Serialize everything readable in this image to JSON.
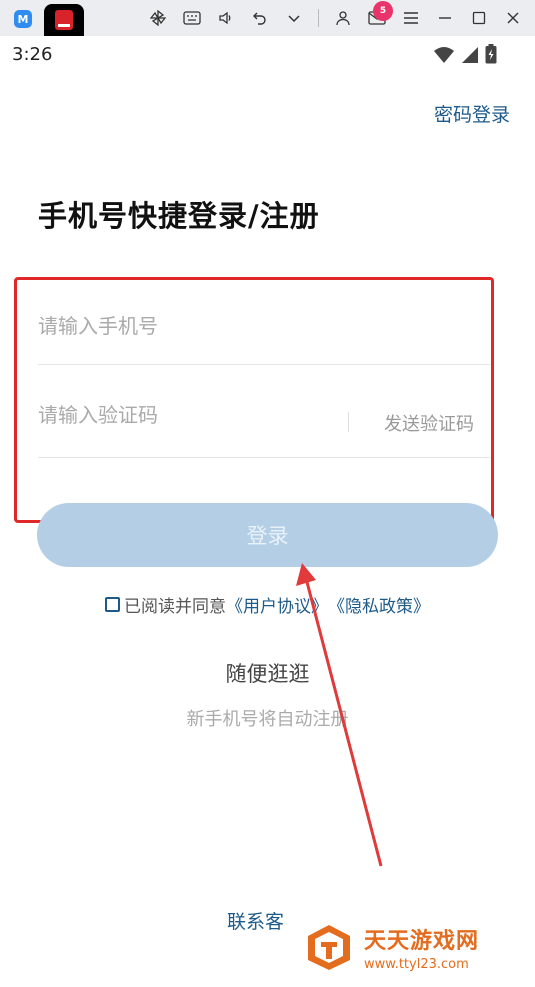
{
  "status_bar": {
    "time": "3:26"
  },
  "emulator": {
    "mail_badge": "5"
  },
  "header": {
    "password_login": "密码登录"
  },
  "page_title": "手机号快捷登录/注册",
  "form": {
    "phone_placeholder": "请输入手机号",
    "phone_value": "",
    "code_placeholder": "请输入验证码",
    "code_value": "",
    "send_code": "发送验证码",
    "login_button": "登录"
  },
  "agreement": {
    "prefix": "已阅读并同意",
    "user_agreement": "《用户协议》",
    "privacy_policy": "《隐私政策》",
    "checked": false
  },
  "browse": {
    "label": "随便逛逛",
    "note": "新手机号将自动注册"
  },
  "footer": {
    "contact": "联系客"
  },
  "watermark": {
    "title": "天天游戏网",
    "url": "www.ttyl23.com"
  },
  "colors": {
    "accent": "#1d5a8a",
    "login_button_bg": "#b4cfe5",
    "highlight_box": "#e02828",
    "watermark": "#e46c1e"
  }
}
